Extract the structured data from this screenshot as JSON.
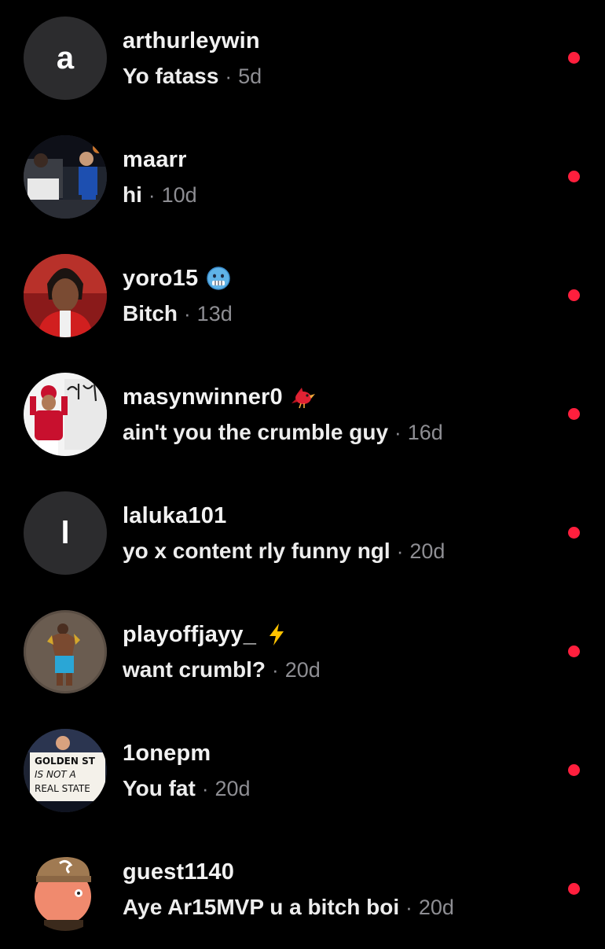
{
  "colors": {
    "background": "#000000",
    "name_text": "#f2f2f2",
    "message_text": "#ededed",
    "meta_text": "#8e8e93",
    "unread_dot": "#ff1f3d",
    "letter_avatar_bg": "#2c2c2e"
  },
  "separator": "·",
  "conversations": [
    {
      "avatar_letter": "a",
      "name": "arthurleywin",
      "badge": "",
      "message": "Yo fatass",
      "age": "5d",
      "unread": true
    },
    {
      "avatar_letter": "",
      "name": "maarr",
      "badge": "",
      "message": "hi",
      "age": "10d",
      "unread": true
    },
    {
      "avatar_letter": "",
      "name": "yoro15",
      "badge": "cold-face-emoji-icon",
      "message": "Bitch",
      "age": "13d",
      "unread": true
    },
    {
      "avatar_letter": "",
      "name": "masynwinner0",
      "badge": "cardinal-bird-emoji-icon",
      "message": "ain't you the crumble guy",
      "age": "16d",
      "unread": true
    },
    {
      "avatar_letter": "l",
      "name": "laluka101",
      "badge": "",
      "message": "yo x content rly funny ngl",
      "age": "20d",
      "unread": true
    },
    {
      "avatar_letter": "",
      "name": "playoffjayy_",
      "badge": "lightning-bolt-emoji-icon",
      "message": "want crumbl?",
      "age": "20d",
      "unread": true
    },
    {
      "avatar_letter": "",
      "name": "1onepm",
      "badge": "",
      "message": "You fat",
      "age": "20d",
      "unread": true,
      "avatar_sign_text": [
        "GOLDEN ST",
        "IS NOT A",
        "REAL STATE"
      ]
    },
    {
      "avatar_letter": "",
      "name": "guest1140",
      "badge": "",
      "message": "Aye Ar15MVP u a bitch boi",
      "age": "20d",
      "unread": true
    }
  ]
}
